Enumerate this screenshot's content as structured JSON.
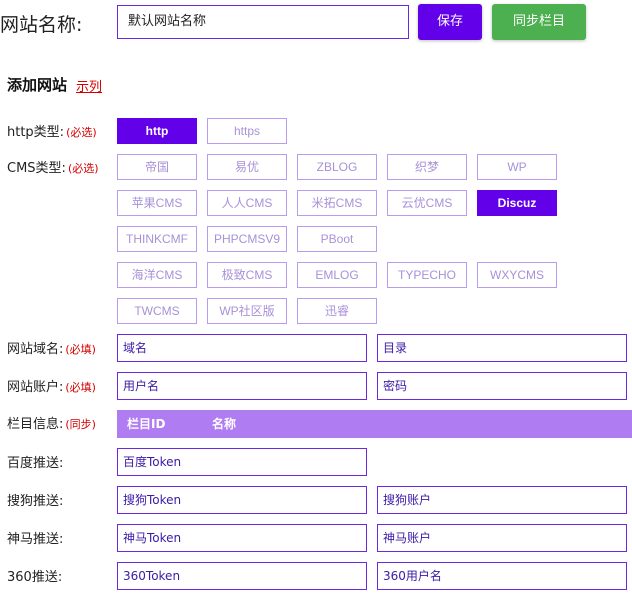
{
  "site": {
    "name_label": "网站名称:",
    "name_value": "默认网站名称",
    "save_label": "保存",
    "sync_label": "同步栏目"
  },
  "add_site": {
    "title": "添加网站",
    "example_link": "示列"
  },
  "http_type": {
    "label": "http类型:",
    "required": "(必选)",
    "options": [
      "http",
      "https"
    ],
    "selected": "http"
  },
  "cms_type": {
    "label": "CMS类型:",
    "required": "(必选)",
    "rows": [
      [
        "帝国",
        "易优",
        "ZBLOG",
        "织梦",
        "WP"
      ],
      [
        "苹果CMS",
        "人人CMS",
        "米拓CMS",
        "云优CMS",
        "Discuz"
      ],
      [
        "THINKCMF",
        "PHPCMSV9",
        "PBoot"
      ],
      [
        "海洋CMS",
        "极致CMS",
        "EMLOG",
        "TYPECHO",
        "WXYCMS"
      ],
      [
        "TWCMS",
        "WP社区版",
        "迅睿"
      ]
    ],
    "selected": "Discuz"
  },
  "domain": {
    "label": "网站域名:",
    "required": "(必填)",
    "domain_placeholder": "域名",
    "dir_placeholder": "目录"
  },
  "account": {
    "label": "网站账户:",
    "required": "(必填)",
    "user_placeholder": "用户名",
    "pass_placeholder": "密码"
  },
  "columns": {
    "label": "栏目信息:",
    "tag": "(同步)",
    "header_id": "栏目ID",
    "header_name": "名称"
  },
  "baidu": {
    "label": "百度推送:",
    "token_placeholder": "百度Token"
  },
  "sogou": {
    "label": "搜狗推送:",
    "token_placeholder": "搜狗Token",
    "account_placeholder": "搜狗账户"
  },
  "shenma": {
    "label": "神马推送:",
    "token_placeholder": "神马Token",
    "account_placeholder": "神马账户"
  },
  "s360": {
    "label": "360推送:",
    "token_placeholder": "360Token",
    "user_placeholder": "360用户名"
  },
  "colors": {
    "accent": "#6200ea",
    "sync_button": "#4caf50",
    "required_text": "#d60000",
    "column_header_bar": "#b07cf2"
  }
}
